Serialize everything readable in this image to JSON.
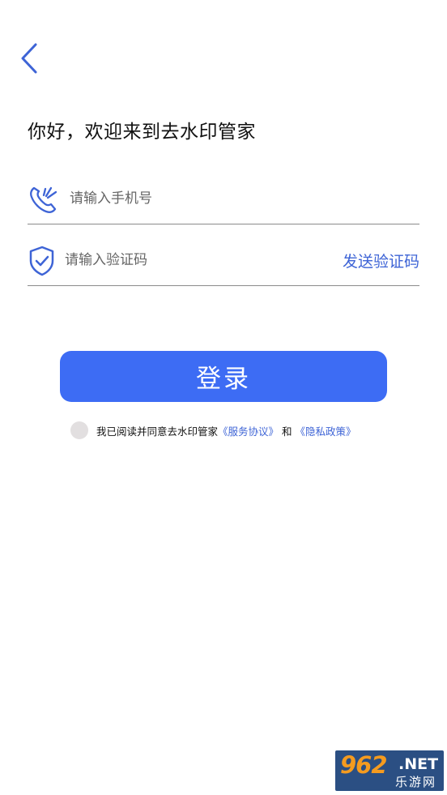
{
  "header": {
    "back_icon": "chevron-left-icon",
    "greeting": "你好，欢迎来到去水印管家"
  },
  "form": {
    "phone": {
      "icon": "phone-icon",
      "placeholder": "请输入手机号",
      "value": ""
    },
    "code": {
      "icon": "shield-check-icon",
      "placeholder": "请输入验证码",
      "value": "",
      "send_label": "发送验证码"
    },
    "login_label": "登录"
  },
  "agreement": {
    "checked": false,
    "prefix": "我已阅读并同意去水印管家",
    "service_link": "《服务协议》",
    "conjunction": "和",
    "privacy_link": "《隐私政策》"
  },
  "watermark": {
    "number": "962",
    "domain": ".NET",
    "name": "乐游网"
  },
  "colors": {
    "accent": "#3d6cf4",
    "link": "#3e64d6",
    "text": "#111111",
    "divider": "#8a8a8a"
  }
}
